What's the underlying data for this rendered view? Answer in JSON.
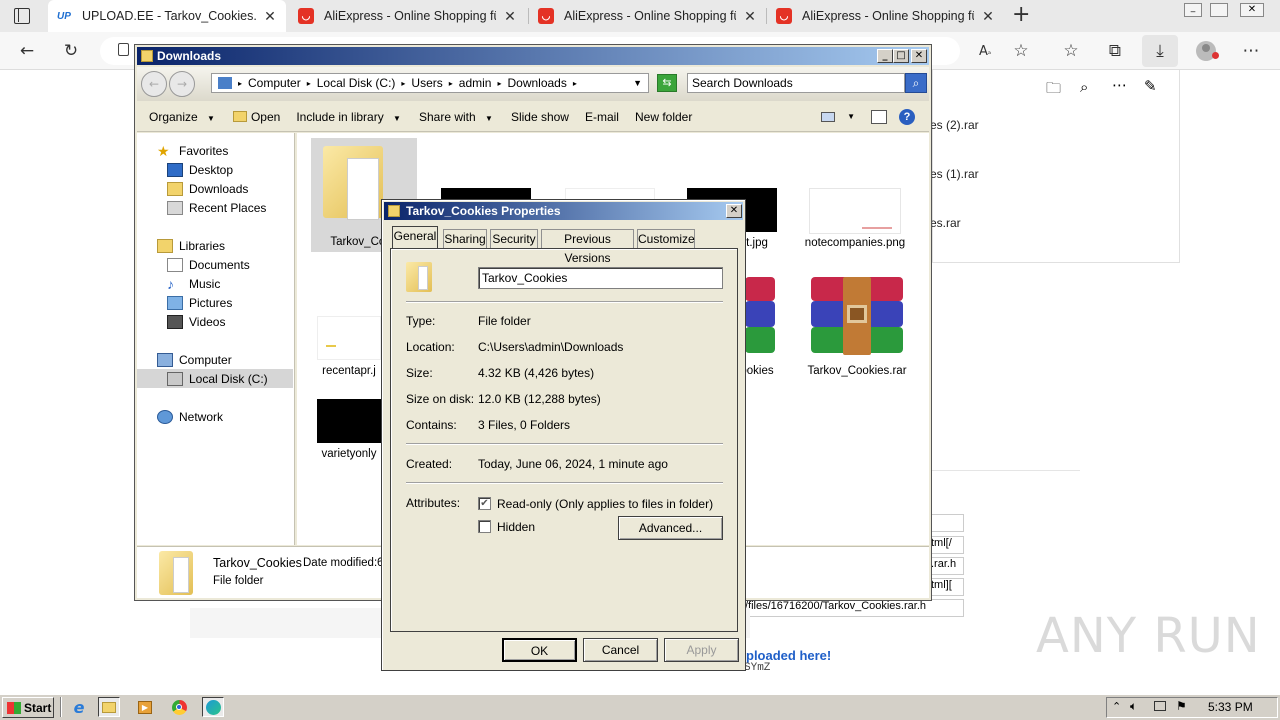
{
  "browser": {
    "tabs": [
      {
        "label": "UPLOAD.EE - Tarkov_Cookies.rar",
        "favicon": "UP"
      },
      {
        "label": "AliExpress - Online Shopping für"
      },
      {
        "label": "AliExpress - Online Shopping für"
      },
      {
        "label": "AliExpress - Online Shopping für"
      }
    ],
    "downloads": [
      "es (2).rar",
      "es (1).rar",
      "es.rar"
    ],
    "page_fragments": {
      "link1": "tml[/",
      "link2": ".rar.h",
      "link3": "tml][",
      "link4": "/files/16716200/Tarkov_Cookies.rar.h",
      "uploaded_text": "ploaded here!",
      "code_text": "SYmZ"
    },
    "colors": {
      "aliexpress": "#e43225",
      "accent": "#0a246a"
    }
  },
  "explorer": {
    "title": "Downloads",
    "breadcrumb": [
      "Computer",
      "Local Disk (C:)",
      "Users",
      "admin",
      "Downloads"
    ],
    "search_placeholder": "Search Downloads",
    "toolbar": {
      "organize": "Organize",
      "open": "Open",
      "include": "Include in library",
      "share": "Share with",
      "slideshow": "Slide show",
      "email": "E-mail",
      "newfolder": "New folder"
    },
    "nav": {
      "favorites": "Favorites",
      "desktop": "Desktop",
      "downloads": "Downloads",
      "recent": "Recent Places",
      "libraries": "Libraries",
      "documents": "Documents",
      "music": "Music",
      "pictures": "Pictures",
      "videos": "Videos",
      "computer": "Computer",
      "localdisk": "Local Disk (C:)",
      "network": "Network"
    },
    "files": {
      "f1": "Tarkov_Coo",
      "f2": "t.jpg",
      "f3": "notecompanies.png",
      "f4": "recentapr.j",
      "f5": "ookies",
      "f6": "Tarkov_Cookies.rar",
      "f7": "varietyonly"
    },
    "details": {
      "name": "Tarkov_Cookies",
      "modified_label": "Date modified:",
      "modified_value": "6",
      "type": "File folder"
    }
  },
  "properties": {
    "title": "Tarkov_Cookies Properties",
    "tabs": [
      "General",
      "Sharing",
      "Security",
      "Previous Versions",
      "Customize"
    ],
    "name_value": "Tarkov_Cookies",
    "type_label": "Type:",
    "type_value": "File folder",
    "location_label": "Location:",
    "location_value": "C:\\Users\\admin\\Downloads",
    "size_label": "Size:",
    "size_value": "4.32 KB (4,426 bytes)",
    "sizeondisk_label": "Size on disk:",
    "sizeondisk_value": "12.0 KB (12,288 bytes)",
    "contains_label": "Contains:",
    "contains_value": "3 Files, 0 Folders",
    "created_label": "Created:",
    "created_value": "Today, June 06, 2024, 1 minute ago",
    "attributes_label": "Attributes:",
    "readonly_label": "Read-only (Only applies to files in folder)",
    "readonly_checked": true,
    "hidden_label": "Hidden",
    "hidden_checked": false,
    "advanced": "Advanced...",
    "ok": "OK",
    "cancel": "Cancel",
    "apply": "Apply"
  },
  "taskbar": {
    "start": "Start",
    "clock": "5:33 PM"
  },
  "watermark": "ANY RUN"
}
